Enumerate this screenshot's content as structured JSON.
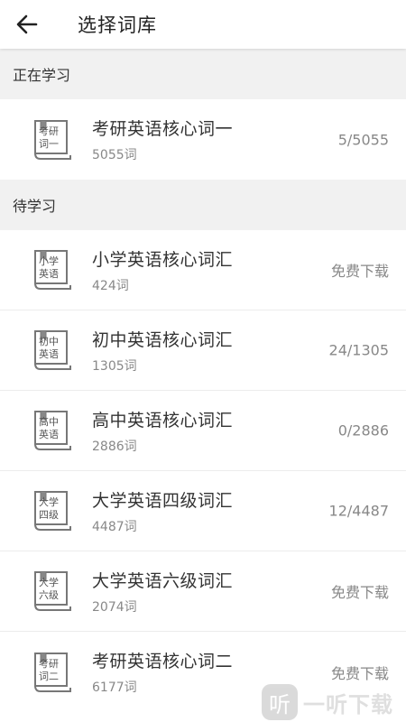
{
  "header": {
    "title": "选择词库",
    "back_icon": "arrow-left-icon"
  },
  "sections": {
    "studying_title": "正在学习",
    "pending_title": "待学习"
  },
  "studying": [
    {
      "book_lines": [
        "考研",
        "词一"
      ],
      "name": "考研英语核心词一",
      "count": "5055词",
      "status": "5/5055"
    }
  ],
  "pending": [
    {
      "book_lines": [
        "小学",
        "英语"
      ],
      "name": "小学英语核心词汇",
      "count": "424词",
      "status": "免费下载"
    },
    {
      "book_lines": [
        "初中",
        "英语"
      ],
      "name": "初中英语核心词汇",
      "count": "1305词",
      "status": "24/1305"
    },
    {
      "book_lines": [
        "高中",
        "英语"
      ],
      "name": "高中英语核心词汇",
      "count": "2886词",
      "status": "0/2886"
    },
    {
      "book_lines": [
        "大学",
        "四级"
      ],
      "name": "大学英语四级词汇",
      "count": "4487词",
      "status": "12/4487"
    },
    {
      "book_lines": [
        "大学",
        "六级"
      ],
      "name": "大学英语六级词汇",
      "count": "2074词",
      "status": "免费下载"
    },
    {
      "book_lines": [
        "考研",
        "词二"
      ],
      "name": "考研英语核心词二",
      "count": "6177词",
      "status": "免费下载"
    }
  ],
  "watermark": {
    "logo": "听",
    "text": "一听下载"
  }
}
